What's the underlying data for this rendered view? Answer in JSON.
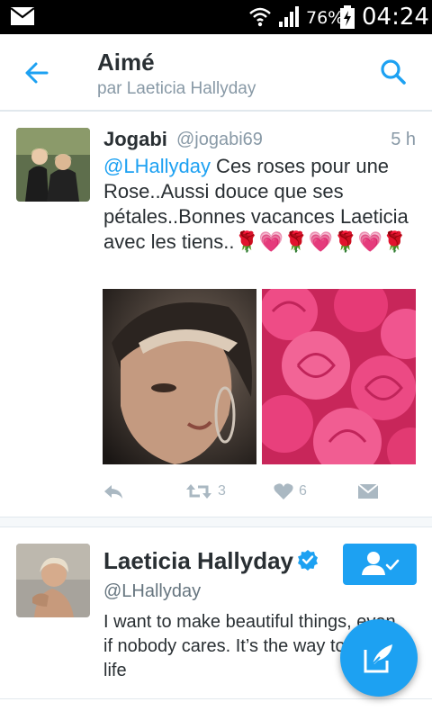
{
  "status_bar": {
    "battery_percent": "76%",
    "time": "04:24",
    "icons": [
      "mail-icon",
      "wifi-icon",
      "signal-icon",
      "battery-charging-icon"
    ]
  },
  "header": {
    "title": "Aimé",
    "subtitle": "par Laeticia Hallyday",
    "icons": [
      "back-arrow-icon",
      "search-icon"
    ]
  },
  "tweet": {
    "author_name": "Jogabi",
    "author_handle": "@jogabi69",
    "time": "5 h",
    "mention": "@LHallyday",
    "text": " Ces roses pour une Rose..Aussi douce que ses pétales..Bonnes vacances Laeticia avec les tiens..",
    "emoji": "🌹💗🌹💗🌹💗🌹",
    "media": [
      "portrait-photo",
      "pink-roses-photo"
    ],
    "retweet_count": "3",
    "like_count": "6",
    "action_icons": [
      "reply-icon",
      "retweet-icon",
      "heart-icon",
      "direct-message-icon"
    ]
  },
  "user_card": {
    "name": "Laeticia Hallyday",
    "handle": "@LHallyday",
    "bio": "I want to make beautiful things, even if nobody cares. It’s the way to live my life",
    "icons": [
      "verified-icon",
      "follow-user-icon"
    ]
  },
  "fab": {
    "icon": "compose-tweet-icon"
  },
  "colors": {
    "accent": "#1da1f2",
    "text": "#292f33",
    "muted": "#8899a6",
    "divider": "#e1e8ed"
  }
}
